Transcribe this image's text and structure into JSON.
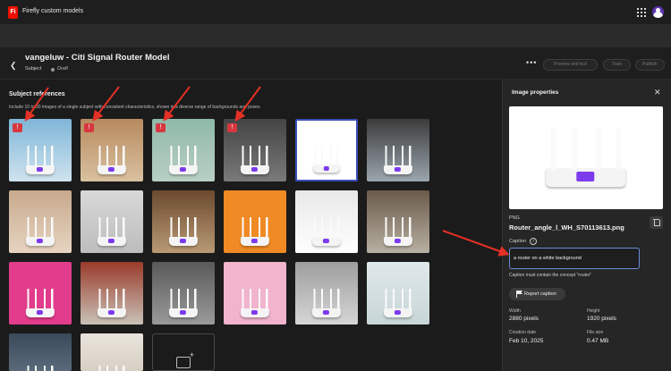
{
  "app": {
    "logo_text": "Fi",
    "title": "Firefly custom models",
    "grid_icon": "apps-grid-icon",
    "avatar_icon": "user-avatar-icon"
  },
  "header": {
    "back_icon": "chevron-left-icon",
    "model_title": "vangeluw - Citi Signal Router Model",
    "subject_label": "Subject",
    "status": "Draft",
    "more_label": "•••",
    "preview_button": "Preview and test",
    "train_button": "Train",
    "publish_button": "Publish"
  },
  "references": {
    "title": "Subject references",
    "description": "Include 10 to 30 images of a single subject with consistent characteristics, shown in a diverse range of backgrounds and poses.",
    "warning_icon": "warning-icon",
    "add_icon": "add-image-icon",
    "images": [
      {
        "bg": "linear-gradient(180deg,#7fb6d8,#cfe3ee)",
        "warning": true
      },
      {
        "bg": "linear-gradient(180deg,#b88a5e,#d9c1a0)",
        "warning": true
      },
      {
        "bg": "linear-gradient(180deg,#8fb9a8,#b9cfc3)",
        "warning": true
      },
      {
        "bg": "linear-gradient(180deg,#444,#7a7a7a)",
        "warning": true
      },
      {
        "bg": "#ffffff",
        "warning": false,
        "selected": true
      },
      {
        "bg": "linear-gradient(180deg,#3b3b3b,#9ba6ae)",
        "warning": false
      },
      {
        "bg": "linear-gradient(180deg,#c7a98d,#e6d4c0)",
        "warning": false
      },
      {
        "bg": "linear-gradient(180deg,#d8d8d8,#bdbdbd)",
        "warning": false
      },
      {
        "bg": "linear-gradient(180deg,#6b4a2e,#b99a74)",
        "warning": false
      },
      {
        "bg": "#f08a24",
        "warning": false
      },
      {
        "bg": "linear-gradient(180deg,#e8e8e8,#ffffff)",
        "warning": false
      },
      {
        "bg": "linear-gradient(180deg,#6a5a4a,#b8b0a2)",
        "warning": false
      },
      {
        "bg": "#e23c8c",
        "warning": false
      },
      {
        "bg": "linear-gradient(180deg,#9a3b2a,#c9c2b8)",
        "warning": false
      },
      {
        "bg": "linear-gradient(180deg,#5a5a5a,#9a9a9a)",
        "warning": false
      },
      {
        "bg": "#f0b4cc",
        "warning": false
      },
      {
        "bg": "linear-gradient(180deg,#9e9e9e,#d6d6d6)",
        "warning": false
      },
      {
        "bg": "linear-gradient(180deg,#dfe8ea,#c8d6d8)",
        "warning": false
      },
      {
        "bg": "linear-gradient(180deg,#3a4a5a,#5a6a7a)",
        "warning": false
      },
      {
        "bg": "linear-gradient(180deg,#e9e4dc,#d7cfc4)",
        "warning": false
      }
    ]
  },
  "panel": {
    "title": "Image properties",
    "close_icon": "close-icon",
    "file_type": "PNG",
    "file_name": "Router_angle_l_WH_S70113613.png",
    "delete_icon": "trash-icon",
    "caption_label": "Caption",
    "info_icon": "info-icon",
    "info_glyph": "i",
    "caption_value": "a router on a white background",
    "caption_hint": "Caption must contain the concept \"router\"",
    "report_button": "Report caption",
    "flag_icon": "flag-icon",
    "width_label": "Width",
    "width_value": "2880 pixels",
    "height_label": "Height",
    "height_value": "1920 pixels",
    "date_label": "Creation date",
    "date_value": "Feb 10, 2025",
    "size_label": "File size",
    "size_value": "0.47 MB"
  },
  "colors": {
    "accent_selected": "#3a4fb8",
    "warning": "#d7373f",
    "annotation_arrow": "#e53025",
    "caption_focus": "#6a8cd9"
  }
}
